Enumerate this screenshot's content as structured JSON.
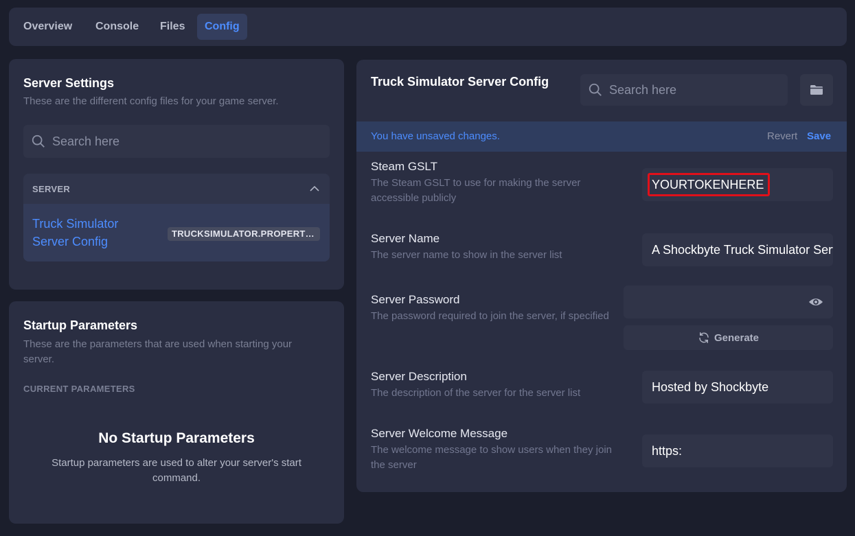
{
  "tabs": [
    {
      "label": "Overview"
    },
    {
      "label": "Console"
    },
    {
      "label": "Files"
    },
    {
      "label": "Config",
      "active": true
    }
  ],
  "server_settings": {
    "title": "Server Settings",
    "subtitle": "These are the different config files for your game server.",
    "search_placeholder": "Search here",
    "group": {
      "label": "SERVER",
      "items": [
        {
          "label": "Truck Simulator Server Config",
          "file": "TRUCKSIMULATOR.PROPERTIES"
        }
      ]
    }
  },
  "startup": {
    "title": "Startup Parameters",
    "subtitle": "These are the parameters that are used when starting your server.",
    "current_label": "CURRENT PARAMETERS",
    "empty_title": "No Startup Parameters",
    "empty_text": "Startup parameters are used to alter your server's start command."
  },
  "config": {
    "title": "Truck Simulator Server Config",
    "search_placeholder": "Search here",
    "unsaved_text": "You have unsaved changes.",
    "revert_label": "Revert",
    "save_label": "Save",
    "fields": [
      {
        "label": "Steam GSLT",
        "description": "The Steam GSLT to use for making the server accessible publicly",
        "value": "YOURTOKENHERE"
      },
      {
        "label": "Server Name",
        "description": "The server name to show in the server list",
        "value": "A Shockbyte Truck Simulator Server"
      },
      {
        "label": "Server Password",
        "description": "The password required to join the server, if specified",
        "value": "",
        "button_label": "Generate"
      },
      {
        "label": "Server Description",
        "description": "The description of the server for the server list",
        "value": "Hosted by Shockbyte"
      },
      {
        "label": "Server Welcome Message",
        "description": "The welcome message to show users when they join the server",
        "value": "https:"
      }
    ]
  },
  "colors": {
    "accent": "#4d8dff",
    "highlight_border": "#e0101a",
    "background": "#1b1e2c",
    "card": "#2a2e42"
  }
}
